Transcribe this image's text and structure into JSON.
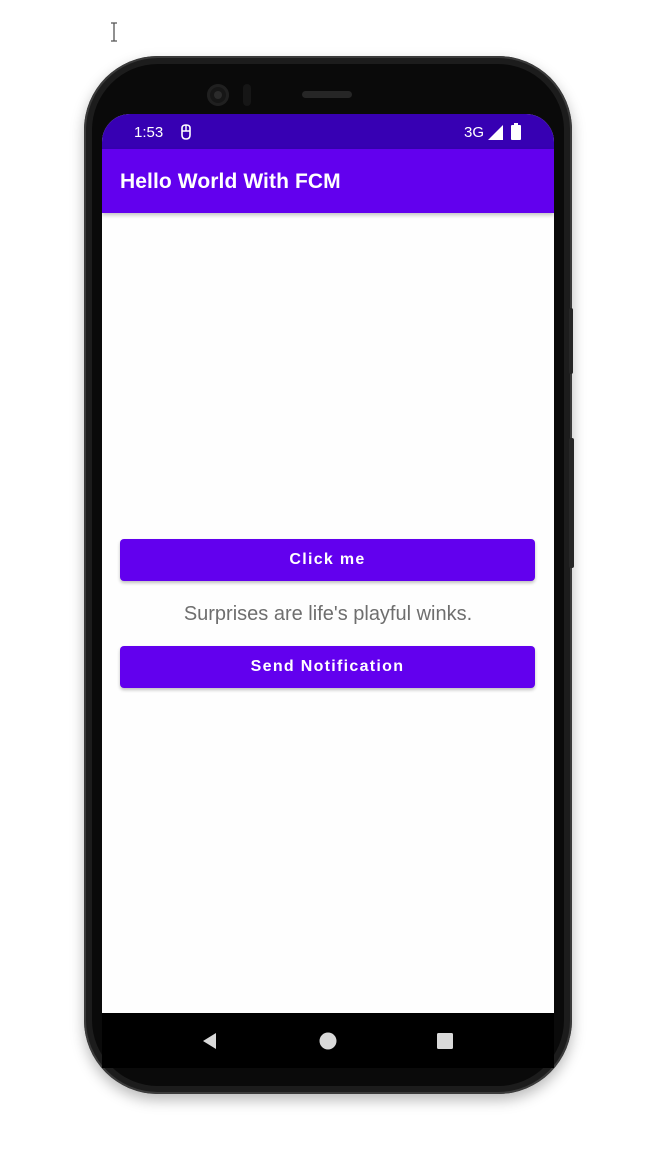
{
  "status_bar": {
    "time": "1:53",
    "network": "3G",
    "app_icon": "notification-app-icon",
    "signal_icon": "signal-icon",
    "battery_icon": "battery-icon",
    "background_color": "#3700b3"
  },
  "app_bar": {
    "title": "Hello World With FCM",
    "background_color": "#6200ee"
  },
  "main": {
    "click_button_label": "Click me",
    "message_text": "Surprises are life's playful winks.",
    "send_notification_button_label": "Send Notification",
    "button_color": "#6200ee",
    "message_color": "#6e6e6e"
  },
  "nav_bar": {
    "back_icon": "back-triangle-icon",
    "home_icon": "home-circle-icon",
    "recents_icon": "recents-square-icon"
  }
}
